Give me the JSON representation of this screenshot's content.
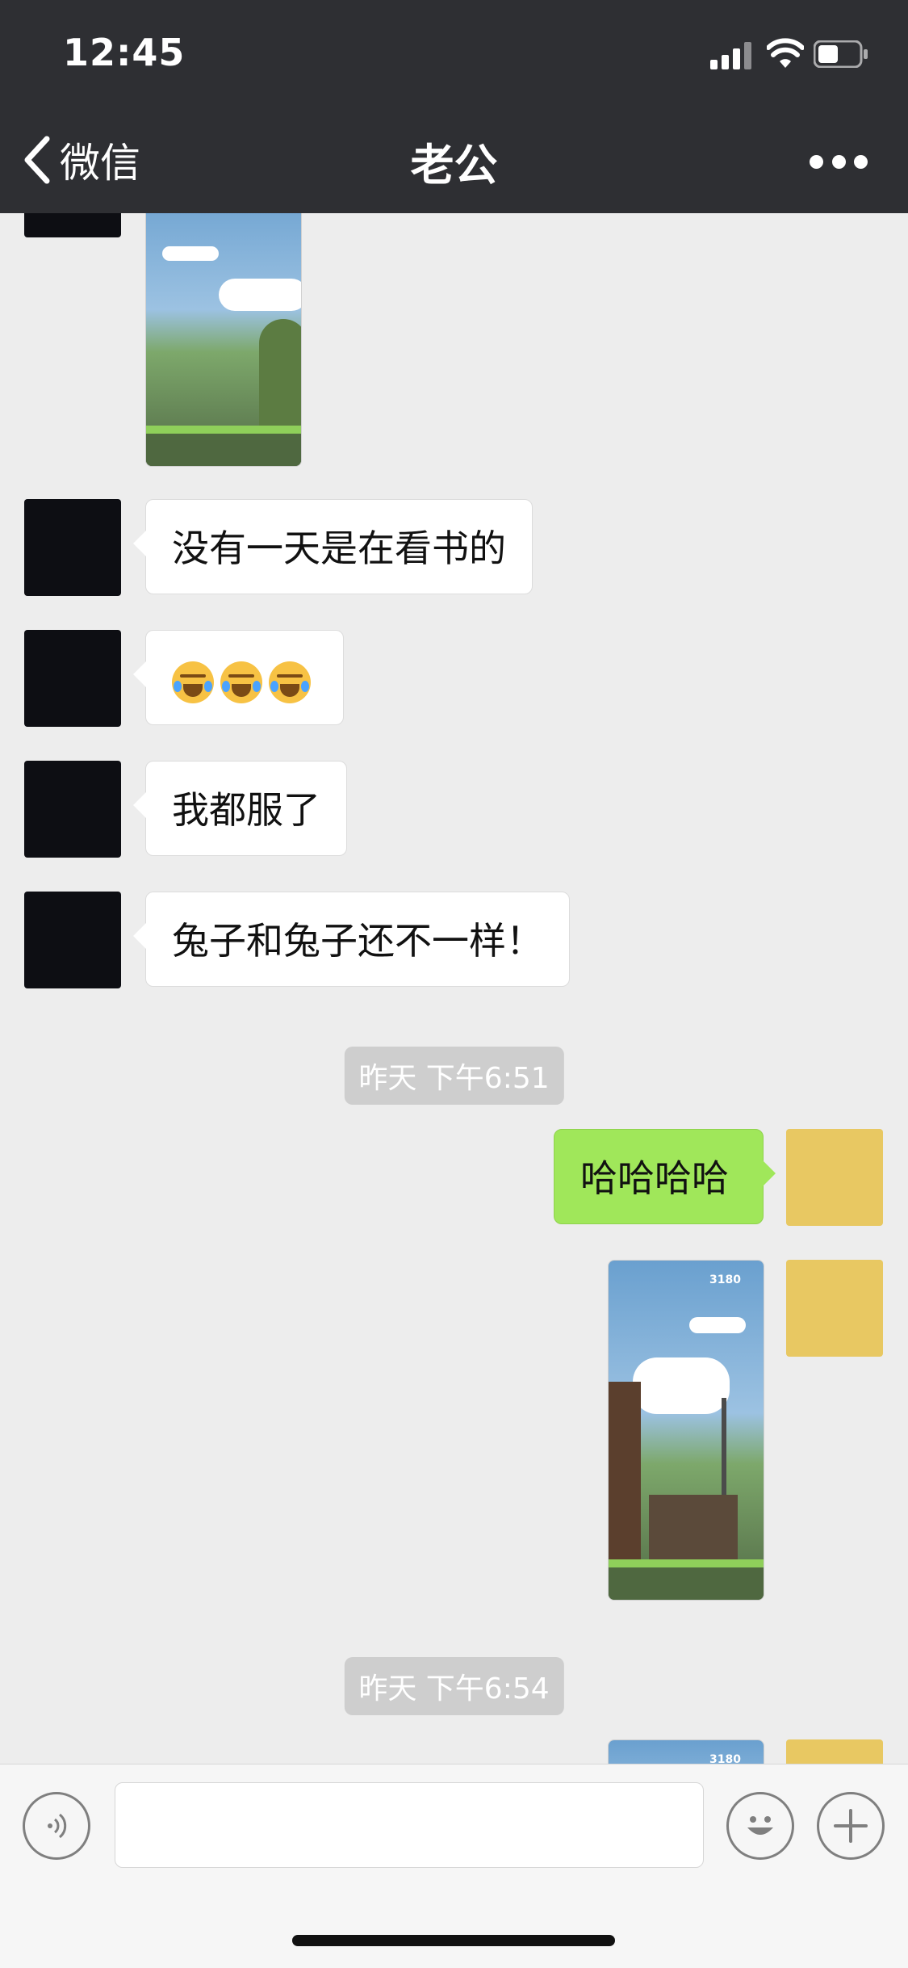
{
  "status_bar": {
    "time": "12:45"
  },
  "nav": {
    "back_label": "微信",
    "title": "老公"
  },
  "messages": {
    "m1": "没有一天是在看书的",
    "m3": "我都服了",
    "m4": "兔子和兔子还不一样！",
    "m5": "哈哈哈哈"
  },
  "emoji_message": {
    "emoji": [
      "face-with-tears",
      "face-with-tears",
      "face-with-tears"
    ]
  },
  "timestamps": {
    "t1": "昨天 下午6:51",
    "t2": "昨天 下午6:54"
  },
  "photos": {
    "p2_score": "3180",
    "p3_score": "3180"
  },
  "icons": [
    "chevron-left-icon",
    "more-icon",
    "voice-icon",
    "emoji-icon",
    "plus-icon"
  ],
  "colors": {
    "nav_bg": "#2e2f33",
    "chat_bg": "#ededed",
    "sent_bubble": "#a0e75a",
    "received_bubble": "#ffffff"
  }
}
